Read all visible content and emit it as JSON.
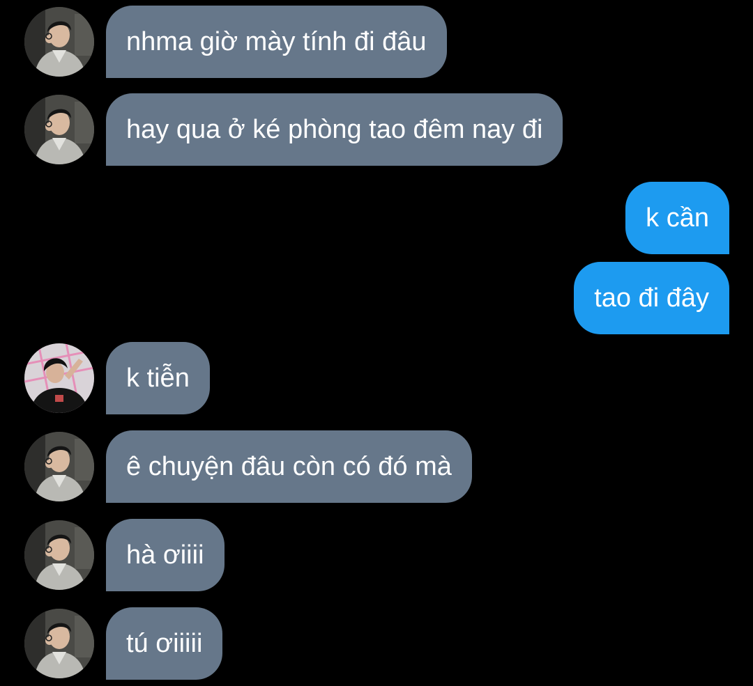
{
  "conversation": {
    "messages": [
      {
        "side": "in",
        "sender": "friend",
        "text": "nhma giờ mày tính đi đâu"
      },
      {
        "side": "in",
        "sender": "friend",
        "text": "hay qua ở ké phòng tao đêm nay đi"
      },
      {
        "side": "out",
        "sender": "me",
        "text": "k cần"
      },
      {
        "side": "out",
        "sender": "me",
        "text": "tao đi đây"
      },
      {
        "side": "in",
        "sender": "other",
        "text": "k tiễn"
      },
      {
        "side": "in",
        "sender": "friend",
        "text": "ê chuyện đâu còn có đó mà"
      },
      {
        "side": "in",
        "sender": "friend",
        "text": "hà ơiiii"
      },
      {
        "side": "in",
        "sender": "friend",
        "text": "tú ơiiiii"
      }
    ]
  },
  "colors": {
    "background": "#000000",
    "incoming_bubble": "#66778a",
    "outgoing_bubble": "#1d9bf0",
    "text": "#ffffff"
  }
}
